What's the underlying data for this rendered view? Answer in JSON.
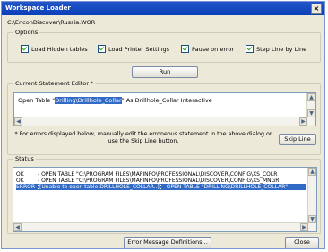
{
  "window": {
    "title": "Workspace Loader",
    "close_glyph": "×",
    "workspace_path": "C:\\EnconDiscover\\Russia.WOR"
  },
  "options": {
    "group_label": "Options",
    "checkboxes": [
      {
        "label": "Load Hidden tables",
        "checked": true
      },
      {
        "label": "Load Printer Settings",
        "checked": true
      },
      {
        "label": "Pause on error",
        "checked": true
      },
      {
        "label": "Step Line by Line",
        "checked": true
      }
    ]
  },
  "run_button": "Run",
  "editor": {
    "group_label": "Current Statement Editor *",
    "prefix": "Open Table \"",
    "selected": "Drilling\\Drillhole_Collar",
    "suffix": "\" As Drillhole_Collar Interactive"
  },
  "note": {
    "text": "* For errors displayed below, manually edit the erroneous statement in the above dialog or use the Skip Line button.",
    "skip_button": "Skip Line"
  },
  "status": {
    "group_label": "Status",
    "rows": [
      {
        "code": "OK",
        "message": "- OPEN TABLE \"C:\\PROGRAM FILES\\MAPINFO\\PROFESSIONAL\\DISCOVER\\CONFIG\\XS_COLR",
        "error": false
      },
      {
        "code": "OK",
        "message": "- OPEN TABLE \"C:\\PROGRAM FILES\\MAPINFO\\PROFESSIONAL\\DISCOVER\\CONFIG\\XS_MNGR",
        "error": false
      },
      {
        "code": "ERROR",
        "detail": "[Unable to open table DRILLHOLE_COLLAR..]",
        "message": "- OPEN TABLE \"DRILLING\\DRILLHOLE_COLLAR\"",
        "error": true
      }
    ]
  },
  "footer": {
    "error_defs_button": "Error Message Definitions...",
    "close_button": "Close"
  },
  "scroll_glyphs": {
    "up": "▲",
    "down": "▼",
    "left": "◀",
    "right": "▶"
  }
}
